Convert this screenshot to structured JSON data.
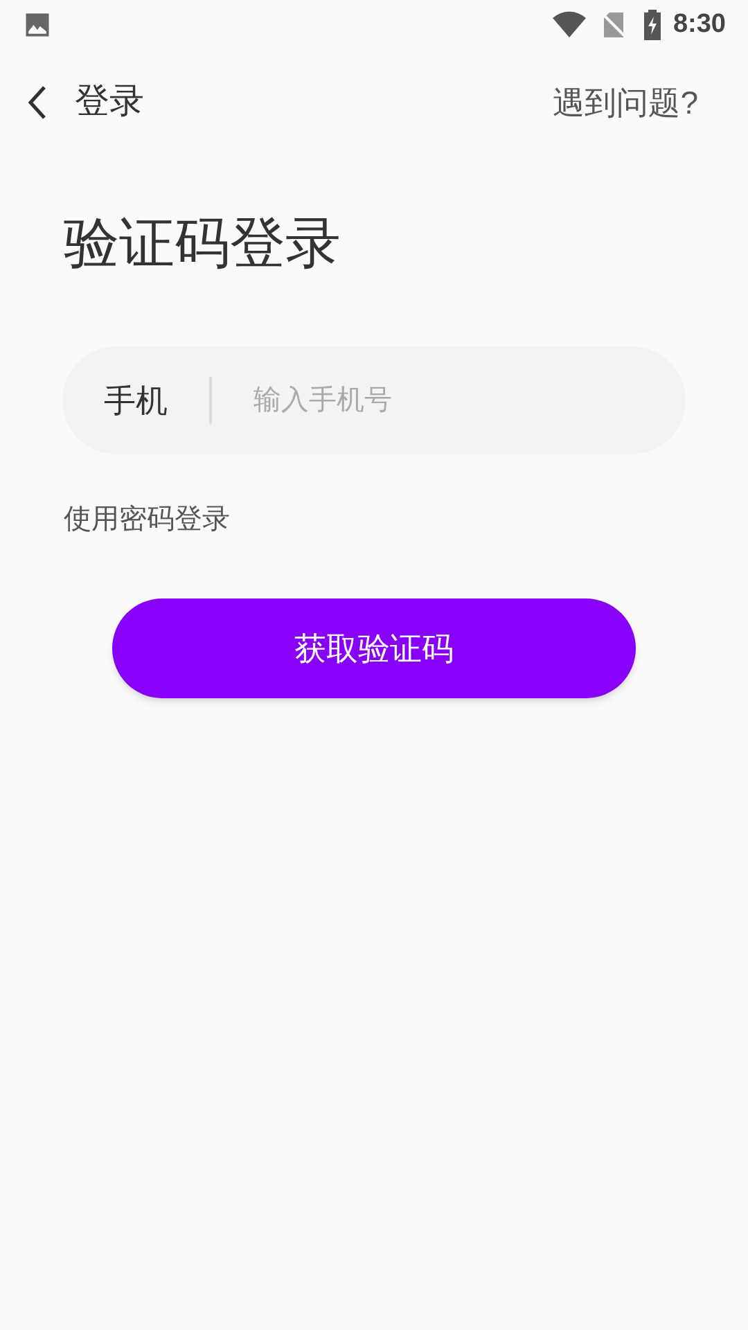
{
  "status_bar": {
    "time": "8:30"
  },
  "header": {
    "back_label": "登录",
    "help_link": "遇到问题?"
  },
  "title": "验证码登录",
  "phone_field": {
    "label": "手机",
    "placeholder": "输入手机号"
  },
  "password_login_link": "使用密码登录",
  "submit_button": "获取验证码"
}
